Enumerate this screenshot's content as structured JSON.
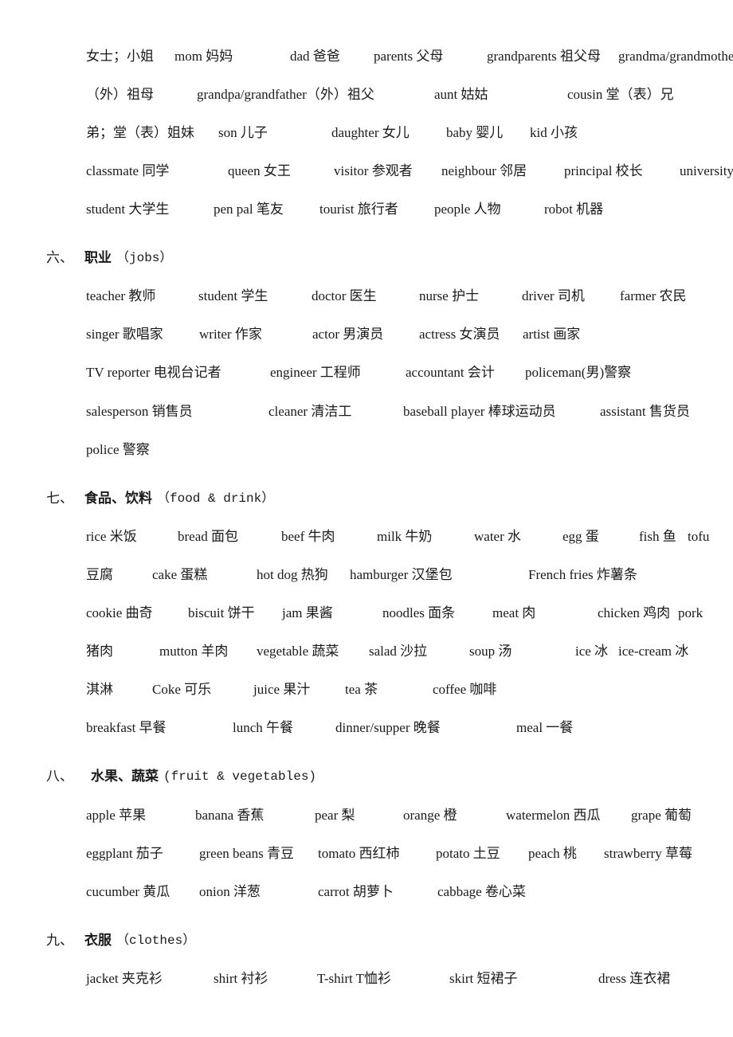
{
  "family_continued": {
    "lines": [
      [
        "女士；小姐",
        "mom 妈妈",
        "dad 爸爸",
        "parents 父母",
        "grandparents 祖父母",
        "grandma/grandmother"
      ],
      [
        "（外）祖母",
        "grandpa/grandfather（外）祖父",
        "aunt 姑姑",
        "cousin 堂（表）兄"
      ],
      [
        "弟；堂（表）姐妹",
        "son 儿子",
        "daughter 女儿",
        "baby 婴儿",
        "kid 小孩"
      ],
      [
        "classmate 同学",
        "queen 女王",
        "visitor 参观者",
        "neighbour 邻居",
        "principal 校长",
        "university"
      ],
      [
        "student 大学生",
        "pen pal 笔友",
        "tourist 旅行者",
        "people 人物",
        "robot 机器"
      ]
    ]
  },
  "sections": [
    {
      "number": "六、",
      "title": "职业",
      "english": "（jobs）",
      "lines": [
        [
          "teacher 教师",
          "student 学生",
          "doctor 医生",
          "nurse 护士",
          "driver 司机",
          "farmer 农民"
        ],
        [
          "singer 歌唱家",
          "writer 作家",
          "actor 男演员",
          "actress 女演员",
          "artist 画家"
        ],
        [
          "TV reporter 电视台记者",
          "engineer 工程师",
          "accountant 会计",
          "policeman(男)警察"
        ],
        [
          "salesperson 销售员",
          "cleaner 清洁工",
          "baseball player 棒球运动员",
          "assistant 售货员"
        ],
        [
          "police 警察"
        ]
      ]
    },
    {
      "number": "七、",
      "title": "食品、饮料",
      "english": "（food & drink）",
      "lines": [
        [
          "rice 米饭",
          "bread 面包",
          "beef 牛肉",
          "milk 牛奶",
          "water 水",
          "egg 蛋",
          "fish 鱼",
          "tofu"
        ],
        [
          "豆腐",
          "cake 蛋糕",
          "hot dog 热狗",
          "hamburger 汉堡包",
          "French fries 炸薯条"
        ],
        [
          "cookie 曲奇",
          "biscuit 饼干",
          "jam 果酱",
          "noodles 面条",
          "meat 肉",
          "chicken 鸡肉",
          "pork"
        ],
        [
          "猪肉",
          "mutton 羊肉",
          "vegetable 蔬菜",
          "salad 沙拉",
          "soup 汤",
          "ice 冰",
          "ice-cream 冰"
        ],
        [
          "淇淋",
          "Coke 可乐",
          "juice 果汁",
          "tea 茶",
          "coffee 咖啡"
        ],
        [
          "breakfast 早餐",
          "lunch 午餐",
          "dinner/supper 晚餐",
          "meal 一餐"
        ]
      ]
    },
    {
      "number": "八、",
      "title": "水果、蔬菜",
      "english": "(fruit & vegetables)",
      "lines": [
        [
          "apple 苹果",
          "banana 香蕉",
          "pear 梨",
          "orange 橙",
          "watermelon 西瓜",
          "grape 葡萄"
        ],
        [
          "eggplant 茄子",
          "green beans 青豆",
          "tomato 西红柿",
          "potato 土豆",
          "peach 桃",
          "strawberry 草莓"
        ],
        [
          "cucumber 黄瓜",
          "onion 洋葱",
          "carrot 胡萝卜",
          "cabbage 卷心菜"
        ]
      ]
    },
    {
      "number": "九、",
      "title": "衣服",
      "english": "（clothes）",
      "lines": [
        [
          "jacket 夹克衫",
          "shirt 衬衫",
          "T-shirt T恤衫",
          "skirt 短裙子",
          "dress 连衣裙"
        ]
      ]
    }
  ]
}
